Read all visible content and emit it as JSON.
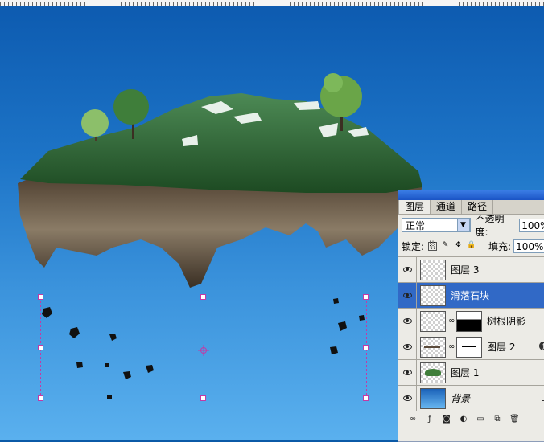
{
  "canvas": {
    "background_top": "#0d5bb0",
    "background_bottom": "#5ab0ee",
    "selection_color": "#c23aa5"
  },
  "layers_panel": {
    "tabs": [
      "图层",
      "通道",
      "路径"
    ],
    "active_tab": "图层",
    "blend_mode": "正常",
    "opacity_label": "不透明度:",
    "opacity_value": "100%",
    "lock_label": "锁定:",
    "fill_label": "填充:",
    "fill_value": "100%",
    "layers": [
      {
        "name": "图层 3",
        "visible": true,
        "selected": false
      },
      {
        "name": "滑落石块",
        "visible": true,
        "selected": true
      },
      {
        "name": "树根阴影",
        "visible": true,
        "selected": false,
        "has_mask": true
      },
      {
        "name": "图层 2",
        "visible": true,
        "selected": false,
        "has_mask": true,
        "has_fx": true
      },
      {
        "name": "图层 1",
        "visible": true,
        "selected": false
      },
      {
        "name": "背景",
        "visible": true,
        "selected": false,
        "locked": true
      }
    ],
    "bottom_icons": [
      "link-icon",
      "fx-icon",
      "mask-icon",
      "adjustment-icon",
      "folder-icon",
      "new-layer-icon",
      "trash-icon"
    ]
  }
}
